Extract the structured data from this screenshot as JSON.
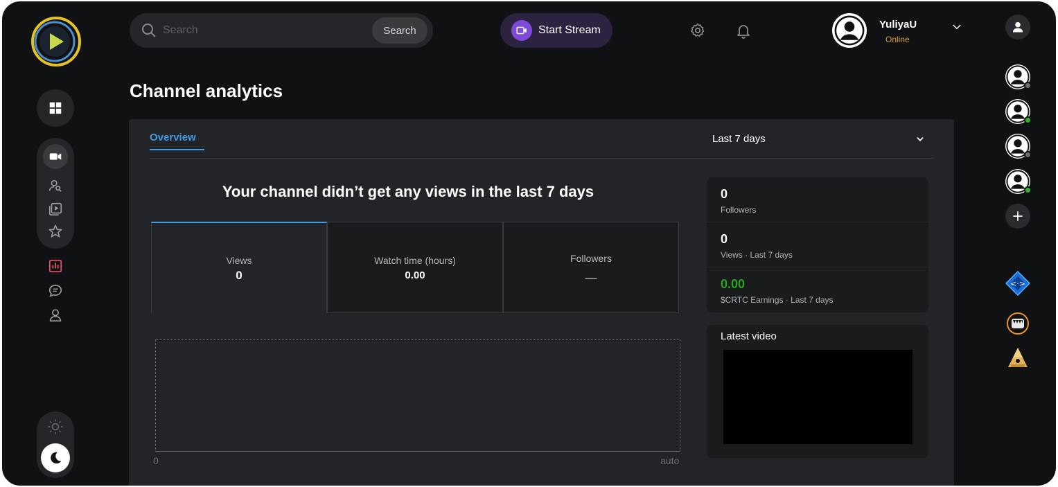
{
  "search": {
    "placeholder": "Search",
    "button_label": "Search"
  },
  "header": {
    "start_stream_label": "Start Stream",
    "username": "YuliyaU",
    "user_status": "Online"
  },
  "page": {
    "title": "Channel analytics"
  },
  "tabs": {
    "overview_label": "Overview",
    "range_label": "Last 7 days"
  },
  "main": {
    "no_views_message": "Your channel didn’t get any views in the last 7 days",
    "metrics": [
      {
        "label": "Views",
        "value": "0"
      },
      {
        "label": "Watch time (hours)",
        "value": "0.00"
      },
      {
        "label": "Followers",
        "value": "—"
      }
    ],
    "chart": {
      "x_start": "0",
      "x_end": "auto"
    }
  },
  "stats": [
    {
      "value": "0",
      "label": "Followers"
    },
    {
      "value": "0",
      "label": "Views · Last 7 days"
    },
    {
      "value": "0.00",
      "label": "$CRTC Earnings · Last 7 days"
    }
  ],
  "latest_video": {
    "title": "Latest video"
  },
  "colors": {
    "accent_blue": "#3d9be9",
    "stream_purple": "#7d4bd8",
    "earnings_green": "#2aa11f",
    "online_orange": "#e0a03a",
    "analytics_red": "#e0506e"
  },
  "icons": {
    "sidebar": [
      "dashboard-icon",
      "camera-icon",
      "people-search-icon",
      "video-library-icon",
      "star-icon",
      "analytics-icon",
      "chat-icon",
      "user-icon"
    ],
    "header": [
      "search-icon",
      "stream-icon",
      "gear-icon",
      "bell-icon",
      "chevron-down-icon"
    ],
    "rail": [
      "user-icon",
      "avatar-icon",
      "plus-icon",
      "crypto-diamond-icon",
      "monster-icon",
      "pyramid-icon"
    ]
  }
}
